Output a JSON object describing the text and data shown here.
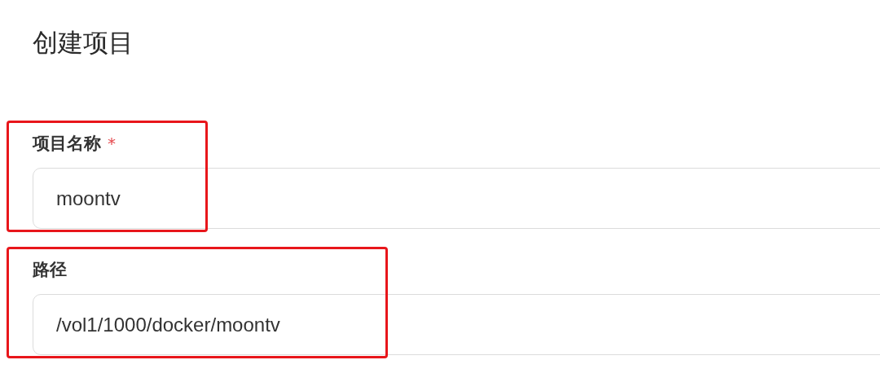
{
  "title": "创建项目",
  "fields": [
    {
      "label": "项目名称",
      "required_mark": "*",
      "value": "moontv",
      "highlighted": true
    },
    {
      "label": "路径",
      "value": "/vol1/1000/docker/moontv",
      "highlighted": true
    }
  ]
}
